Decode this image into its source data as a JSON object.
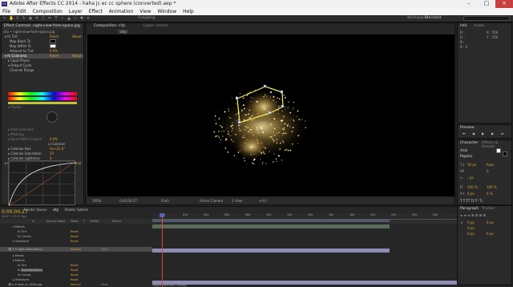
{
  "window": {
    "title": "Adobe After Effects CC 2014 - haha jc ec cc sphere (converted).aep *",
    "icon": "Ae"
  },
  "menu": [
    "File",
    "Edit",
    "Composition",
    "Layer",
    "Effect",
    "Animation",
    "View",
    "Window",
    "Help"
  ],
  "toolbar": {
    "snapping": "Snapping",
    "workspace_label": "Workspace:",
    "workspace_value": "Standard",
    "search_placeholder": "Search Help"
  },
  "effect_controls": {
    "tab": "Effect Controls: night-view-from-space.jpg",
    "layer": "city • night-view-from-space.jpg",
    "rows": [
      {
        "label": "Tint",
        "value": "Reset",
        "about": "About"
      },
      {
        "label": "Map Black To",
        "value": "",
        "about": ""
      },
      {
        "label": "Map White To",
        "value": "",
        "about": ""
      },
      {
        "label": "Amount to Tint",
        "value": "0.0%",
        "about": ""
      },
      {
        "label": "Colorama",
        "value": "Reset",
        "about": "About"
      },
      {
        "label": "Input Phase",
        "value": "",
        "about": ""
      },
      {
        "label": "Output Cycle",
        "value": "",
        "about": ""
      },
      {
        "label": "Channel Range",
        "value": "",
        "about": ""
      },
      {
        "label": "Modify",
        "value": "",
        "about": ""
      },
      {
        "label": "Pixel Selection",
        "value": "",
        "about": ""
      },
      {
        "label": "Masking",
        "value": "",
        "about": ""
      },
      {
        "label": "Blend With Original",
        "value": "0.0%",
        "about": ""
      },
      {
        "label": "Colorize",
        "value": "",
        "about": ""
      },
      {
        "label": "Colorize Hue",
        "value": "0x+22.0°",
        "about": ""
      },
      {
        "label": "Colorize Saturation",
        "value": "25",
        "about": ""
      },
      {
        "label": "Colorize Lightness",
        "value": "0",
        "about": ""
      },
      {
        "label": "Curves",
        "value": "Reset",
        "about": "About"
      },
      {
        "label": "Channel:",
        "value": "RGB",
        "about": ""
      },
      {
        "label": "Curves",
        "value": "",
        "about": ""
      }
    ]
  },
  "composition": {
    "tab": "Composition: city",
    "layer_tab": "Layer: (none)",
    "breadcrumb": "city",
    "footer": {
      "zoom": "100%",
      "timecode": "0;00;00;27",
      "resolution": "(Full)",
      "camera": "Active Camera",
      "views": "1 View",
      "offset": "+0.0"
    }
  },
  "info_panel": {
    "tab": "Info",
    "tab2": "Audio",
    "r": "R :",
    "g": "G :",
    "b": "B :",
    "a": "A : 0",
    "x": "X : 556",
    "y": "Y : 378"
  },
  "preview_panel": {
    "tab": "Preview"
  },
  "character_panel": {
    "tab": "Character",
    "tab2": "Effects & Presets",
    "font": "Arial",
    "style": "Regular",
    "size": "36 px",
    "leading": "Auto",
    "tracking": "0",
    "stroke": "- px",
    "scale_v": "100 %",
    "scale_h": "100 %",
    "baseline": "0 px",
    "tsume": "0 %"
  },
  "paragraph_panel": {
    "tab": "Paragraph",
    "tab2": "Tracker",
    "indent_1": "0 px",
    "indent_2": "0 px",
    "indent_3": "0 px",
    "space_1": "0 px",
    "space_2": "0 px"
  },
  "timeline": {
    "timecode": "0;00;00;27",
    "fps": "00027 (29.97 fps)",
    "tabs": [
      "Render Queue",
      "city",
      "Shader Sphere"
    ],
    "headers": [
      "#",
      "Source Name",
      "Mode",
      "T",
      "TrkMat",
      "Parent"
    ],
    "ruler": [
      "0s",
      "02s",
      "04s",
      "06s",
      "08s",
      "10s",
      "12s",
      "14s",
      "16s",
      "18s",
      "20s",
      "22s",
      "24s",
      "26s",
      "28s"
    ],
    "rows": [
      {
        "label": "Effects",
        "mode": "",
        "parent": ""
      },
      {
        "label": "Tint",
        "mode": "Reset",
        "parent": ""
      },
      {
        "label": "Curves",
        "mode": "Reset",
        "parent": ""
      },
      {
        "label": "Transform",
        "mode": "Reset",
        "parent": ""
      },
      {
        "label": "3  night-view-from-s...",
        "mode": "Normal",
        "parent": "None"
      },
      {
        "label": "Masks",
        "mode": "",
        "parent": ""
      },
      {
        "label": "Effects",
        "mode": "",
        "parent": ""
      },
      {
        "label": "Tint",
        "mode": "Reset",
        "parent": ""
      },
      {
        "label": "Hue/Saturation",
        "mode": "Reset",
        "parent": ""
      },
      {
        "label": "Curves",
        "mode": "Reset",
        "parent": ""
      },
      {
        "label": "Transform",
        "mode": "Reset",
        "parent": ""
      },
      {
        "label": "4  land_cc_3048.jpg",
        "mode": "Normal",
        "parent": "None"
      }
    ],
    "footer": "Toggle Switches / Modes"
  }
}
